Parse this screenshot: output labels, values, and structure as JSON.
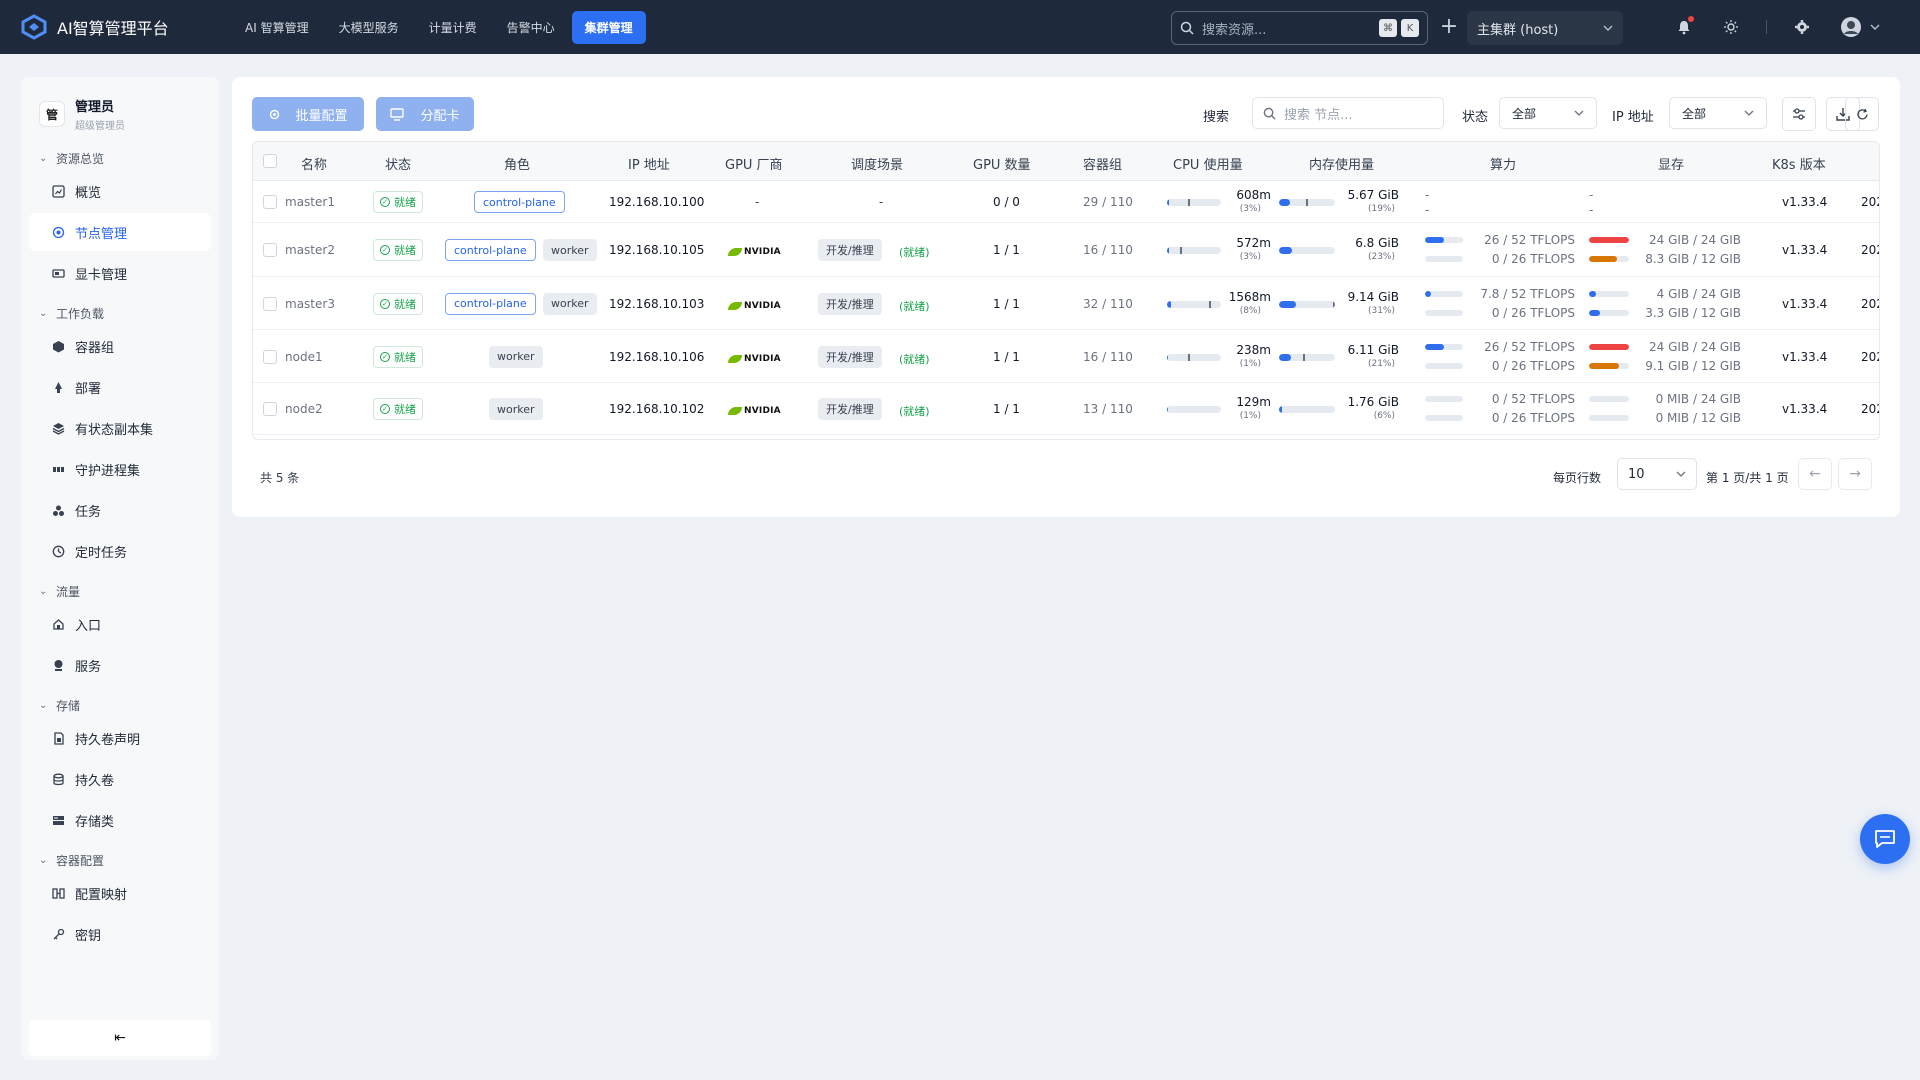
{
  "app": {
    "title": "AI智算管理平台"
  },
  "topnav": [
    {
      "label": "AI 智算管理",
      "active": false
    },
    {
      "label": "大模型服务",
      "active": false
    },
    {
      "label": "计量计费",
      "active": false
    },
    {
      "label": "告警中心",
      "active": false
    },
    {
      "label": "集群管理",
      "active": true
    }
  ],
  "search": {
    "placeholder": "搜索资源...",
    "kbd1": "⌘",
    "kbd2": "K"
  },
  "cluster": {
    "selected": "主集群 (host)"
  },
  "user": {
    "name": "管理员",
    "role": "超级管理员",
    "avatar_char": "管"
  },
  "sidebar": {
    "groups": [
      {
        "label": "资源总览",
        "items": [
          {
            "label": "概览",
            "icon": "chart-icon"
          },
          {
            "label": "节点管理",
            "icon": "node-icon",
            "active": true
          },
          {
            "label": "显卡管理",
            "icon": "gpu-card-icon"
          }
        ]
      },
      {
        "label": "工作负载",
        "items": [
          {
            "label": "容器组",
            "icon": "cube-icon"
          },
          {
            "label": "部署",
            "icon": "deploy-icon"
          },
          {
            "label": "有状态副本集",
            "icon": "layers-icon"
          },
          {
            "label": "守护进程集",
            "icon": "daemon-icon"
          },
          {
            "label": "任务",
            "icon": "task-icon"
          },
          {
            "label": "定时任务",
            "icon": "clock-icon"
          }
        ]
      },
      {
        "label": "流量",
        "items": [
          {
            "label": "入口",
            "icon": "ingress-icon"
          },
          {
            "label": "服务",
            "icon": "service-icon"
          }
        ]
      },
      {
        "label": "存储",
        "items": [
          {
            "label": "持久卷声明",
            "icon": "pvc-icon"
          },
          {
            "label": "持久卷",
            "icon": "pv-icon"
          },
          {
            "label": "存储类",
            "icon": "storage-class-icon"
          }
        ]
      },
      {
        "label": "容器配置",
        "items": [
          {
            "label": "配置映射",
            "icon": "configmap-icon"
          },
          {
            "label": "密钥",
            "icon": "key-icon"
          }
        ]
      }
    ]
  },
  "toolbar": {
    "batch_config": "批量配置",
    "assign_card": "分配卡",
    "search_label": "搜索",
    "search_placeholder": "搜索 节点...",
    "status_label": "状态",
    "status_value": "全部",
    "ip_label": "IP 地址",
    "ip_value": "全部"
  },
  "table": {
    "columns": [
      "名称",
      "状态",
      "角色",
      "IP 地址",
      "GPU 厂商",
      "调度场景",
      "GPU 数量",
      "容器组",
      "CPU 使用量",
      "内存使用量",
      "算力",
      "显存",
      "K8s 版本",
      "202"
    ],
    "rows": [
      {
        "name": "master1",
        "status": "就绪",
        "roles": [
          "control-plane"
        ],
        "ip": "192.168.10.100",
        "vendor": "-",
        "sched": "-",
        "sched_status": "",
        "gpu_count": "0 / 0",
        "pods": "29 / 110",
        "cpu_value": "608m",
        "cpu_pct": "(3%)",
        "cpu_fill": 3,
        "cpu_req": 38,
        "mem_value": "5.67 GiB",
        "mem_pct": "(19%)",
        "mem_fill": 19,
        "mem_req": 48,
        "compute": [
          "-",
          "-"
        ],
        "compute_fill": [],
        "vram": [
          "-",
          "-"
        ],
        "vram_fill": [],
        "k8s": "v1.33.4",
        "created": "202"
      },
      {
        "name": "master2",
        "status": "就绪",
        "roles": [
          "control-plane",
          "worker"
        ],
        "ip": "192.168.10.105",
        "vendor": "NVIDIA",
        "sched": "开发/推理",
        "sched_status": "(就绪)",
        "gpu_count": "1 / 1",
        "pods": "16 / 110",
        "cpu_value": "572m",
        "cpu_pct": "(3%)",
        "cpu_fill": 3,
        "cpu_req": 24,
        "mem_value": "6.8 GiB",
        "mem_pct": "(23%)",
        "mem_fill": 23,
        "mem_req": 0,
        "compute": [
          "26 / 52 TFLOPS",
          "0 / 26 TFLOPS"
        ],
        "compute_fill": [
          50,
          0
        ],
        "vram": [
          "24 GIB / 24 GIB",
          "8.3 GIB / 12 GIB"
        ],
        "vram_fill": [
          100,
          69
        ],
        "vram_colors": [
          "#ef4444",
          "#d97706"
        ],
        "k8s": "v1.33.4",
        "created": "202"
      },
      {
        "name": "master3",
        "status": "就绪",
        "roles": [
          "control-plane",
          "worker"
        ],
        "ip": "192.168.10.103",
        "vendor": "NVIDIA",
        "sched": "开发/推理",
        "sched_status": "(就绪)",
        "gpu_count": "1 / 1",
        "pods": "32 / 110",
        "cpu_value": "1568m",
        "cpu_pct": "(8%)",
        "cpu_fill": 8,
        "cpu_req": 78,
        "mem_value": "9.14 GiB",
        "mem_pct": "(31%)",
        "mem_fill": 31,
        "mem_req": 96,
        "compute": [
          "7.8 / 52 TFLOPS",
          "0 / 26 TFLOPS"
        ],
        "compute_fill": [
          15,
          0
        ],
        "vram": [
          "4 GIB / 24 GIB",
          "3.3 GIB / 12 GIB"
        ],
        "vram_fill": [
          17,
          27
        ],
        "vram_colors": [
          "#2f6fed",
          "#2f6fed"
        ],
        "k8s": "v1.33.4",
        "created": "202"
      },
      {
        "name": "node1",
        "status": "就绪",
        "roles": [
          "worker"
        ],
        "ip": "192.168.10.106",
        "vendor": "NVIDIA",
        "sched": "开发/推理",
        "sched_status": "(就绪)",
        "gpu_count": "1 / 1",
        "pods": "16 / 110",
        "cpu_value": "238m",
        "cpu_pct": "(1%)",
        "cpu_fill": 1,
        "cpu_req": 38,
        "mem_value": "6.11 GiB",
        "mem_pct": "(21%)",
        "mem_fill": 21,
        "mem_req": 42,
        "compute": [
          "26 / 52 TFLOPS",
          "0 / 26 TFLOPS"
        ],
        "compute_fill": [
          50,
          0
        ],
        "vram": [
          "24 GIB / 24 GIB",
          "9.1 GIB / 12 GIB"
        ],
        "vram_fill": [
          100,
          76
        ],
        "vram_colors": [
          "#ef4444",
          "#d97706"
        ],
        "k8s": "v1.33.4",
        "created": "202"
      },
      {
        "name": "node2",
        "status": "就绪",
        "roles": [
          "worker"
        ],
        "ip": "192.168.10.102",
        "vendor": "NVIDIA",
        "sched": "开发/推理",
        "sched_status": "(就绪)",
        "gpu_count": "1 / 1",
        "pods": "13 / 110",
        "cpu_value": "129m",
        "cpu_pct": "(1%)",
        "cpu_fill": 1,
        "cpu_req": 0,
        "mem_value": "1.76 GiB",
        "mem_pct": "(6%)",
        "mem_fill": 6,
        "mem_req": 0,
        "compute": [
          "0 / 52 TFLOPS",
          "0 / 26 TFLOPS"
        ],
        "compute_fill": [
          0,
          0
        ],
        "vram": [
          "0 MIB / 24 GIB",
          "0 MIB / 12 GIB"
        ],
        "vram_fill": [
          0,
          0
        ],
        "vram_colors": [
          "#2f6fed",
          "#2f6fed"
        ],
        "k8s": "v1.33.4",
        "created": "202"
      }
    ]
  },
  "footer": {
    "total": "共 5 条",
    "rows_per_page_label": "每页行数",
    "rows_per_page": "10",
    "page_info": "第 1 页/共 1 页",
    "prev": "←",
    "next": "→"
  },
  "colors": {
    "accent": "#2d6ff2",
    "topbar": "#1e2a3b",
    "ok": "#16a34a"
  }
}
